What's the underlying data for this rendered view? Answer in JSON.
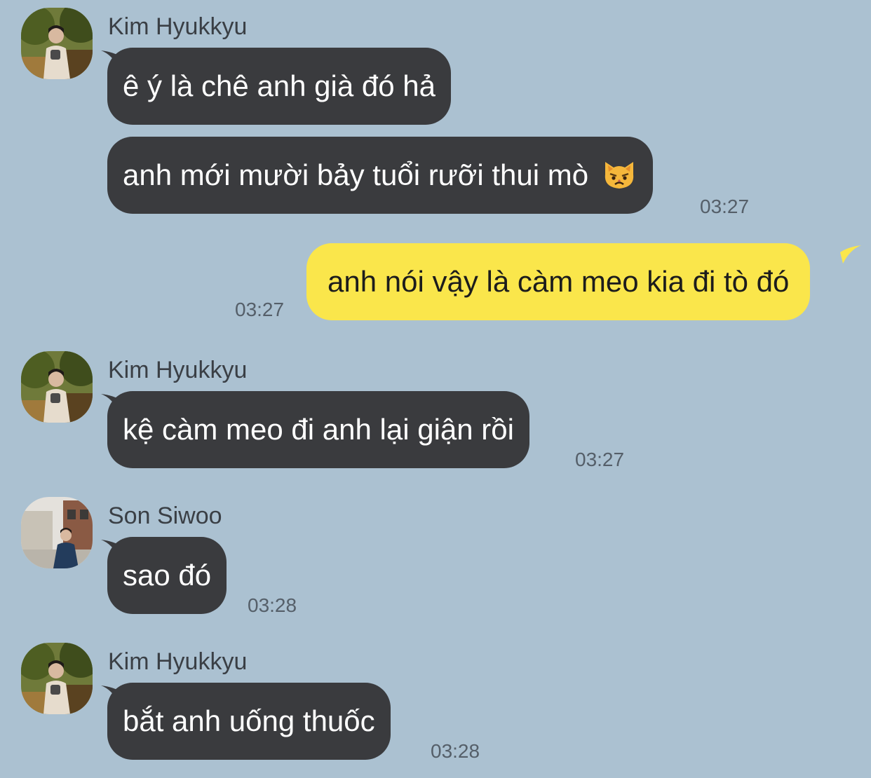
{
  "colors": {
    "background": "#abc1d1",
    "incoming_bubble": "#3a3b3e",
    "outgoing_bubble": "#fae64b"
  },
  "messages": [
    {
      "sender": "Kim Hyukkyu",
      "text": "ê ý là chê anh già đó hả"
    },
    {
      "text": "anh mới mười bảy tuổi rưỡi thui mò",
      "emoji": "pouting-cat-icon",
      "time": "03:27"
    },
    {
      "text": "anh nói vậy là càm meo kia đi tò đó",
      "time": "03:27"
    },
    {
      "sender": "Kim Hyukkyu",
      "text": "kệ càm meo đi anh lại giận rồi",
      "time": "03:27"
    },
    {
      "sender": "Son Siwoo",
      "text": "sao đó",
      "time": "03:28"
    },
    {
      "sender": "Kim Hyukkyu",
      "text": "bắt anh uống thuốc",
      "time": "03:28"
    }
  ]
}
